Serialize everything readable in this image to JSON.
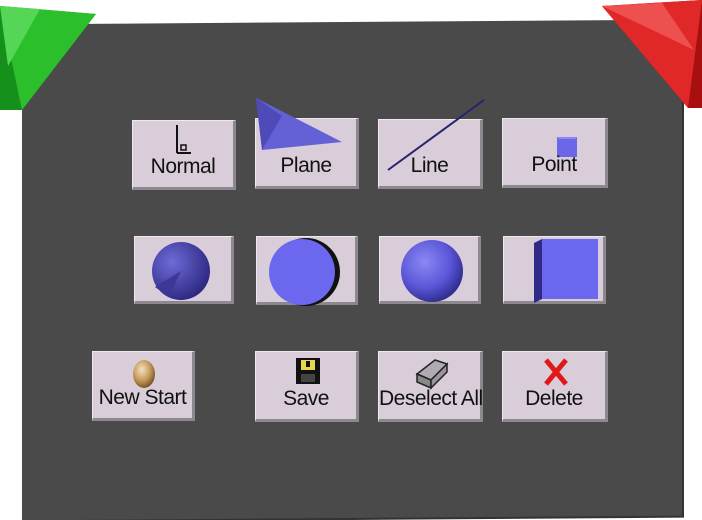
{
  "corners": {
    "left_color": "#1fa81f",
    "right_color": "#d82020"
  },
  "rows": {
    "modes": [
      {
        "label": "Normal",
        "icon": "normal-angle-icon"
      },
      {
        "label": "Plane",
        "icon": "plane-triangle-icon"
      },
      {
        "label": "Line",
        "icon": "line-icon"
      },
      {
        "label": "Point",
        "icon": "point-square-icon"
      }
    ],
    "shapes": [
      {
        "icon": "cone-icon"
      },
      {
        "icon": "cylinder-icon"
      },
      {
        "icon": "sphere-icon"
      },
      {
        "icon": "cube-icon"
      }
    ],
    "actions": [
      {
        "label": "New Start",
        "icon": "egg-icon"
      },
      {
        "label": "Save",
        "icon": "floppy-disk-icon"
      },
      {
        "label": "Deselect All",
        "icon": "eraser-icon"
      },
      {
        "label": "Delete",
        "icon": "red-x-icon"
      }
    ]
  },
  "colors": {
    "panel": "#4a4a4a",
    "button": "#d8cdd8",
    "shape_fill": "#6b67e6",
    "shape_dark": "#3a3690"
  }
}
